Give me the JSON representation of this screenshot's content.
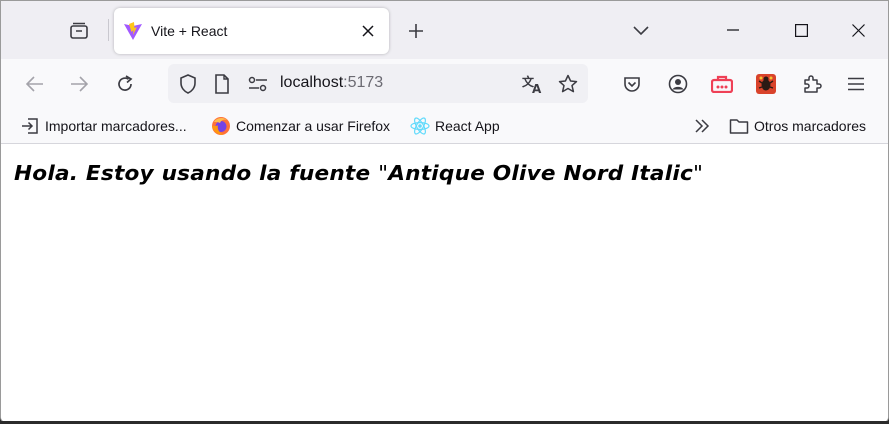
{
  "browser": {
    "tab": {
      "title": "Vite + React",
      "favicon": "vite-logo-icon"
    },
    "address": {
      "host": "localhost",
      "port": ":5173"
    },
    "bookmarks": [
      {
        "label": "Importar marcadores...",
        "icon": "import-icon"
      },
      {
        "label": "Comenzar a usar Firefox",
        "icon": "firefox-icon"
      },
      {
        "label": "React App",
        "icon": "react-icon"
      }
    ],
    "other_bookmarks": "Otros marcadores"
  },
  "page": {
    "heading_prefix": "Hola. Estoy usando la fuente ",
    "heading_quote_open": "\"",
    "heading_font_name": "Antique Olive Nord Italic",
    "heading_quote_close": "\""
  },
  "colors": {
    "tabstrip_bg": "#efeef3",
    "toolbar_bg": "#f9f9fb",
    "urlbar_bg": "#f0f0f4",
    "vite_purple": "#a259ff",
    "vite_yellow": "#ffc517",
    "firefox_orange": "#ff7139",
    "react_blue": "#61dafb",
    "pocket_red": "#ef4056"
  }
}
